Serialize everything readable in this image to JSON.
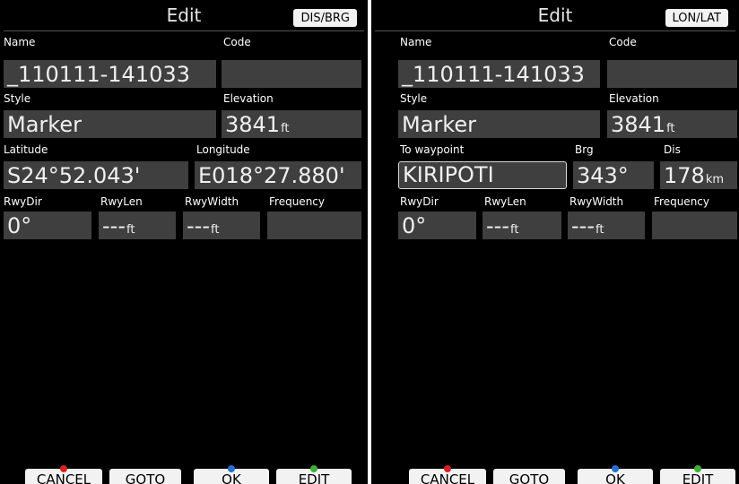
{
  "left": {
    "title": "Edit",
    "mode_button": "DIS/BRG",
    "name_label": "Name",
    "name_value": "_110111-141033",
    "code_label": "Code",
    "code_value": "",
    "style_label": "Style",
    "style_value": "Marker",
    "elevation_label": "Elevation",
    "elevation_value": "3841",
    "elevation_unit": "ft",
    "latitude_label": "Latitude",
    "latitude_value": "S24°52.043'",
    "longitude_label": "Longitude",
    "longitude_value": "E018°27.880'",
    "rwydir_label": "RwyDir",
    "rwydir_value": "0°",
    "rwylen_label": "RwyLen",
    "rwylen_value": "---",
    "rwylen_unit": "ft",
    "rwywidth_label": "RwyWidth",
    "rwywidth_value": "---",
    "rwywidth_unit": "ft",
    "frequency_label": "Frequency",
    "frequency_value": "",
    "softkeys": {
      "cancel": "CANCEL",
      "goto": "GOTO",
      "ok": "OK",
      "edit": "EDIT"
    }
  },
  "right": {
    "title": "Edit",
    "mode_button": "LON/LAT",
    "name_label": "Name",
    "name_value": "_110111-141033",
    "code_label": "Code",
    "code_value": "",
    "style_label": "Style",
    "style_value": "Marker",
    "elevation_label": "Elevation",
    "elevation_value": "3841",
    "elevation_unit": "ft",
    "to_waypoint_label": "To waypoint",
    "to_waypoint_value": "KIRIPOTI",
    "brg_label": "Brg",
    "brg_value": "343°",
    "dis_label": "Dis",
    "dis_value": "178",
    "dis_unit": "km",
    "rwydir_label": "RwyDir",
    "rwydir_value": "0°",
    "rwylen_label": "RwyLen",
    "rwylen_value": "---",
    "rwylen_unit": "ft",
    "rwywidth_label": "RwyWidth",
    "rwywidth_value": "---",
    "rwywidth_unit": "ft",
    "frequency_label": "Frequency",
    "frequency_value": "",
    "softkeys": {
      "cancel": "CANCEL",
      "goto": "GOTO",
      "ok": "OK",
      "edit": "EDIT"
    }
  },
  "colors": {
    "screen_background": "#000000",
    "field_background": "#3f3f3f",
    "button_background": "#f2f2f2",
    "cancel_indicator": "#d62222",
    "ok_indicator": "#2470d6",
    "edit_indicator": "#3fae3a"
  }
}
